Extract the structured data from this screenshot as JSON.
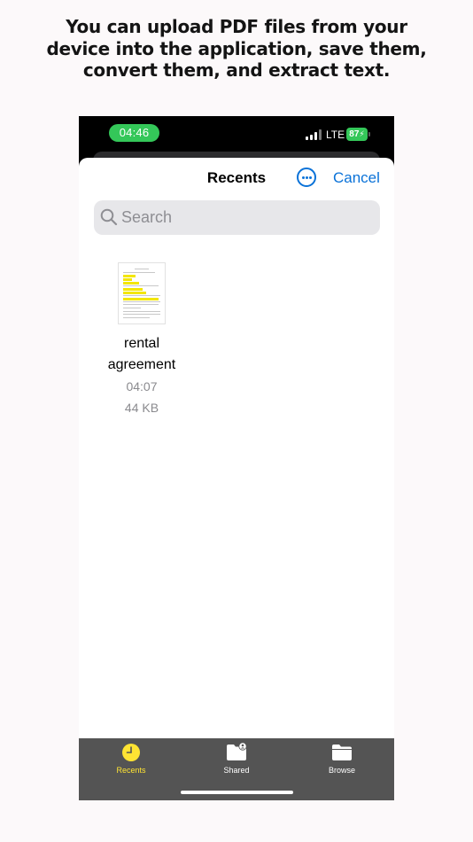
{
  "headline": {
    "line1": "You can upload PDF files from your",
    "line2": "device into the application, save them,",
    "line3": "convert them, and extract text."
  },
  "status_bar": {
    "time": "04:46",
    "network": "LTE",
    "battery": "87"
  },
  "nav": {
    "title": "Recents",
    "more_icon": "ellipsis-circle-icon",
    "cancel": "Cancel"
  },
  "search": {
    "placeholder": "Search",
    "value": ""
  },
  "files": [
    {
      "name_line1": "rental",
      "name_line2": "agreement",
      "time": "04:07",
      "size": "44 KB"
    }
  ],
  "tabs": [
    {
      "label": "Recents",
      "icon": "clock-icon",
      "active": true
    },
    {
      "label": "Shared",
      "icon": "shared-folder-icon",
      "active": false
    },
    {
      "label": "Browse",
      "icon": "folder-icon",
      "active": false
    }
  ],
  "colors": {
    "accent_blue": "#0a72d8",
    "active_tab": "#ffe433",
    "status_green": "#34c759",
    "tab_bar": "#545454"
  }
}
